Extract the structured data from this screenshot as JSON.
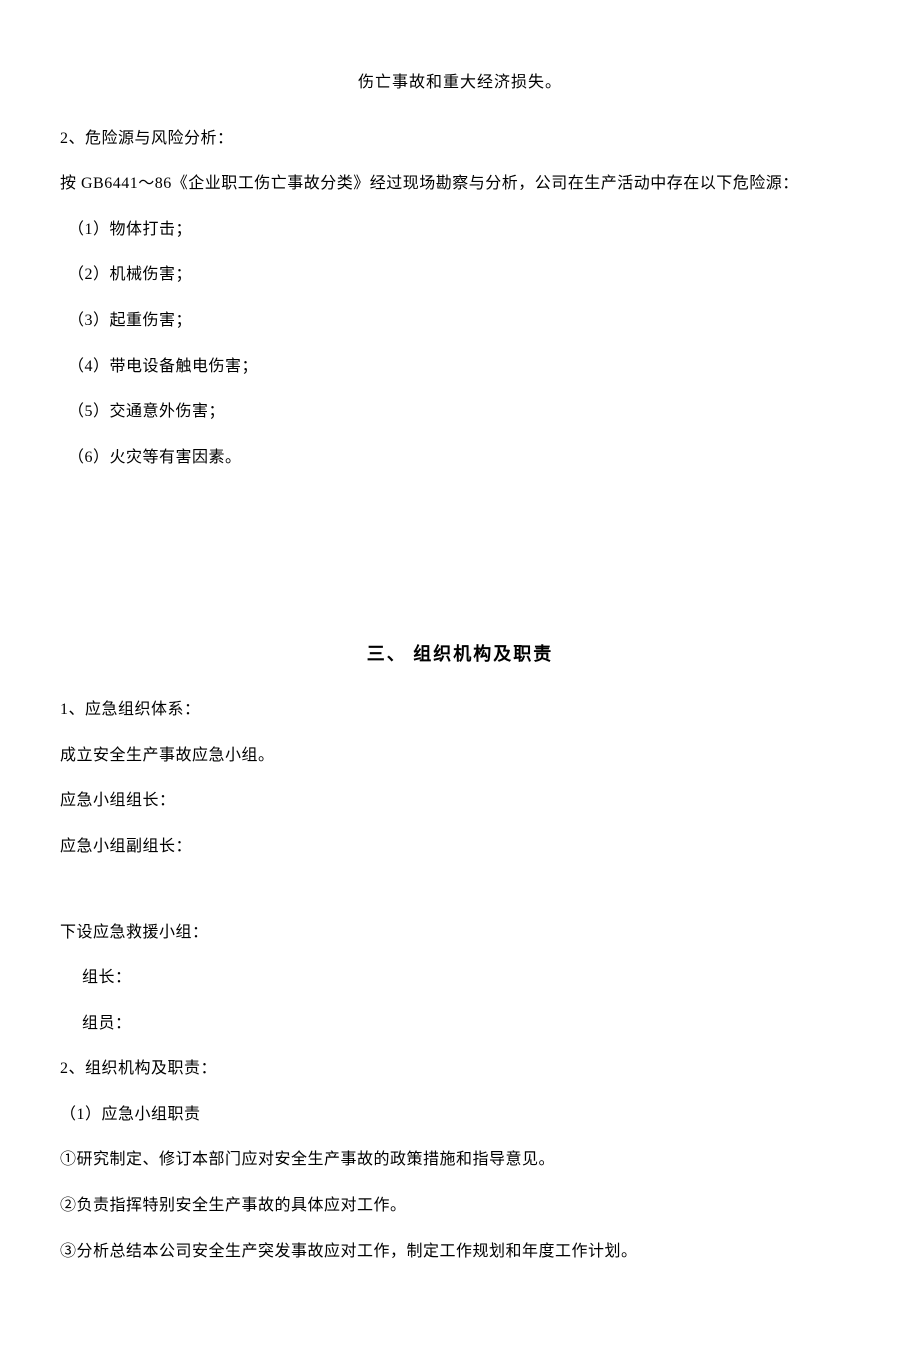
{
  "top_center": "伤亡事故和重大经济损失。",
  "risk_heading": "2、危险源与风险分析：",
  "risk_intro": "按 GB6441～86《企业职工伤亡事故分类》经过现场勘察与分析，公司在生产活动中存在以下危险源：",
  "risk_items": [
    "（1）物体打击；",
    "（2）机械伤害；",
    "（3）起重伤害；",
    "（4）带电设备触电伤害；",
    "（5）交通意外伤害；",
    "（6）火灾等有害因素。"
  ],
  "section3_title": "三、  组织机构及职责",
  "org_heading": "1、应急组织体系：",
  "org_lines": [
    "成立安全生产事故应急小组。",
    "应急小组组长：",
    "应急小组副组长："
  ],
  "subteam_line": "下设应急救援小组：",
  "subteam_leader": "组长：",
  "subteam_member": "组员：",
  "duty_heading": "2、组织机构及职责：",
  "duty_sub": "（1）应急小组职责",
  "duty_items": [
    "①研究制定、修订本部门应对安全生产事故的政策措施和指导意见。",
    "②负责指挥特别安全生产事故的具体应对工作。",
    "③分析总结本公司安全生产突发事故应对工作，制定工作规划和年度工作计划。"
  ]
}
